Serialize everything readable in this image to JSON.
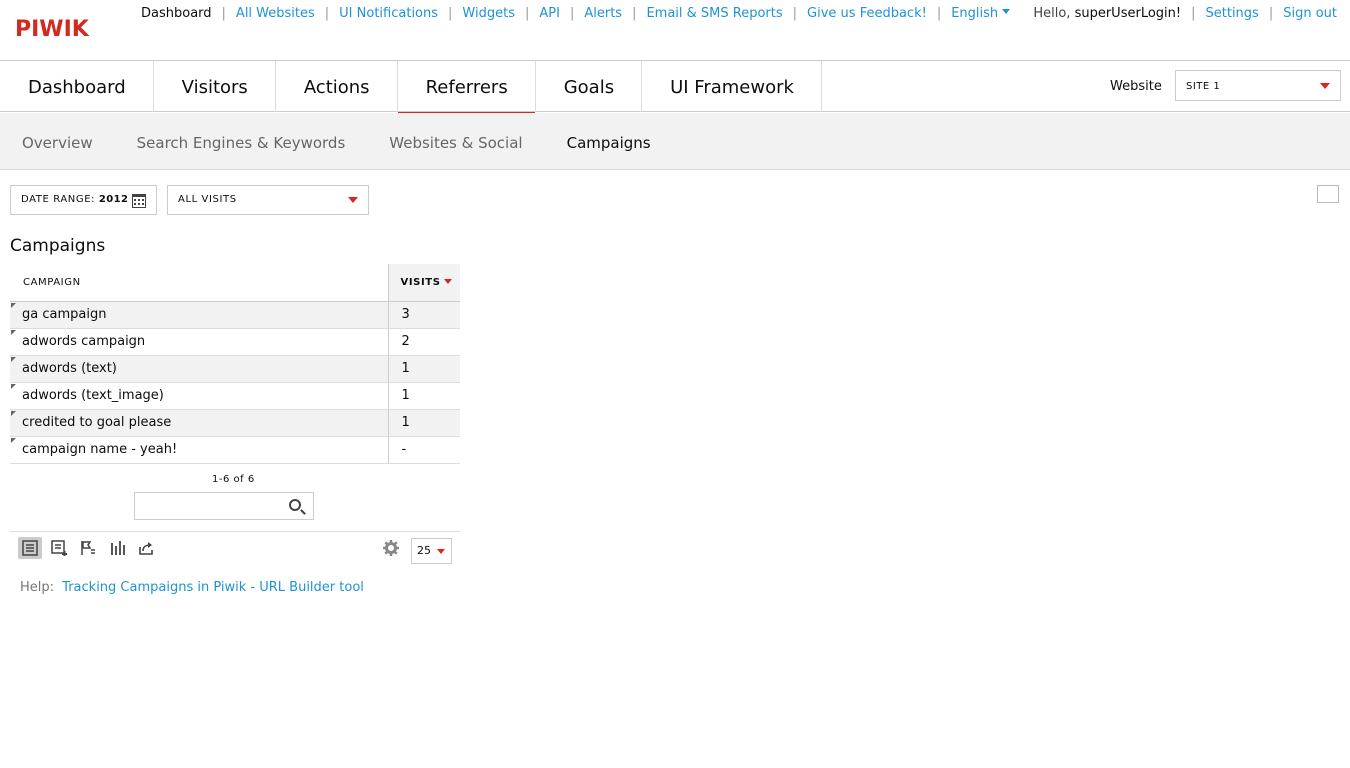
{
  "logo": "PIWIK",
  "topnav": {
    "items": [
      "Dashboard",
      "All Websites",
      "UI Notifications",
      "Widgets",
      "API",
      "Alerts",
      "Email & SMS Reports",
      "Give us Feedback!",
      "English"
    ]
  },
  "user": {
    "hello": "Hello,",
    "username": "superUserLogin!",
    "settings": "Settings",
    "signout": "Sign out"
  },
  "mainmenu": {
    "tabs": [
      "Dashboard",
      "Visitors",
      "Actions",
      "Referrers",
      "Goals",
      "UI Framework"
    ],
    "active": "Referrers"
  },
  "site": {
    "label": "Website",
    "selected": "SITE 1"
  },
  "submenu": {
    "items": [
      "Overview",
      "Search Engines & Keywords",
      "Websites & Social",
      "Campaigns"
    ],
    "active": "Campaigns"
  },
  "daterange": {
    "label": "DATE RANGE:",
    "value": "2012"
  },
  "segment": {
    "value": "ALL VISITS"
  },
  "report": {
    "title": "Campaigns",
    "columns": [
      "CAMPAIGN",
      "VISITS"
    ],
    "rows": [
      {
        "label": "ga campaign",
        "visits": "3"
      },
      {
        "label": "adwords campaign",
        "visits": "2"
      },
      {
        "label": "adwords (text)",
        "visits": "1"
      },
      {
        "label": "adwords (text_image)",
        "visits": "1"
      },
      {
        "label": "credited to goal please",
        "visits": "1"
      },
      {
        "label": "campaign name - yeah!",
        "visits": "-"
      }
    ],
    "pagination": "1-6 of 6",
    "search_placeholder": "",
    "limit": "25"
  },
  "icons": {
    "viz": [
      "table-icon",
      "table-more-icon",
      "goals-table-icon",
      "bar-chart-icon",
      "export-icon"
    ],
    "settings": "gear-icon"
  },
  "help": {
    "label": "Help:",
    "link": "Tracking Campaigns in Piwik - URL Builder tool"
  },
  "colors": {
    "accent": "#d4291f",
    "link": "#1e93d1"
  }
}
